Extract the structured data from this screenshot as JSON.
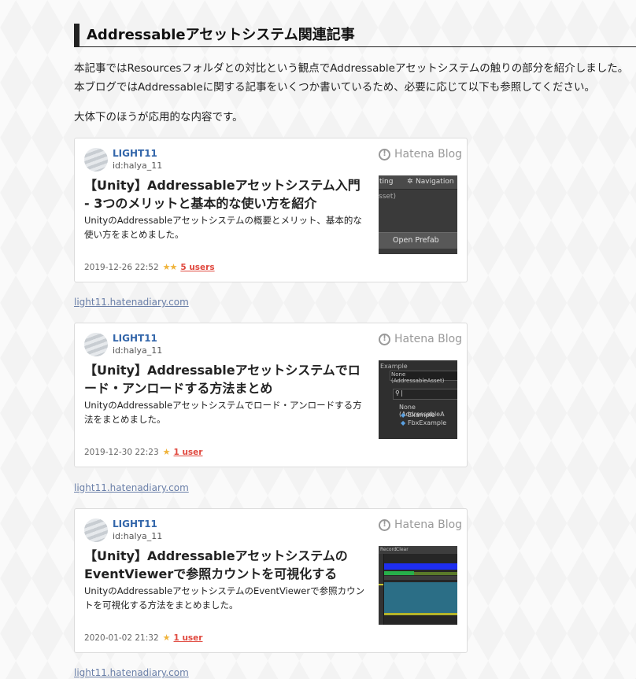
{
  "section": {
    "heading": "Addressableアセットシステム関連記事",
    "intro_line1": "本記事ではResourcesフォルダとの対比という観点でAddressableアセットシステムの触りの部分を紹介しました。",
    "intro_line2": "本ブログではAddressableに関する記事をいくつか書いているため、必要に応じて以下も参照してください。",
    "note": "大体下のほうが応用的な内容です。"
  },
  "cards": [
    {
      "author": "LIGHT11",
      "author_id": "id:halya_11",
      "blog_brand": "Hatena Blog",
      "title": "【Unity】Addressableアセットシステム入門 - 3つのメリットと基本的な使い方を紹介",
      "description": "UnityのAddressableアセットシステムの概要とメリット、基本的な使い方をまとめました。",
      "date": "2019-12-26 22:52",
      "stars": "★★",
      "users": "5 users",
      "link": "light11.hatenadiary.com",
      "thumb": {
        "tab": "ting",
        "nav": "Navigation",
        "asset": "sset)",
        "button": "Open Prefab"
      }
    },
    {
      "author": "LIGHT11",
      "author_id": "id:halya_11",
      "blog_brand": "Hatena Blog",
      "title": "【Unity】Addressableアセットシステムでロード・アンロードする方法まとめ",
      "description": "UnityのAddressableアセットシステムでロード・アンロードする方法をまとめました。",
      "date": "2019-12-30 22:23",
      "stars": "★",
      "users": "1 user",
      "link": "light11.hatenadiary.com",
      "thumb": {
        "top": "Example",
        "field": "None (AddressableAsset)",
        "search": "|",
        "none": "None (AddressableA",
        "item1": "Example",
        "item2": "FbxExample"
      }
    },
    {
      "author": "LIGHT11",
      "author_id": "id:halya_11",
      "blog_brand": "Hatena Blog",
      "title": "【Unity】AddressableアセットシステムのEventViewerで参照カウントを可視化する",
      "description": "UnityのAddressableアセットシステムのEventViewerで参照カウントを可視化する方法をまとめました。",
      "date": "2020-01-02 21:32",
      "stars": "★",
      "users": "1 user",
      "link": "light11.hatenadiary.com",
      "thumb": {
        "tab1": "Record",
        "tab2": "Clear"
      }
    }
  ]
}
